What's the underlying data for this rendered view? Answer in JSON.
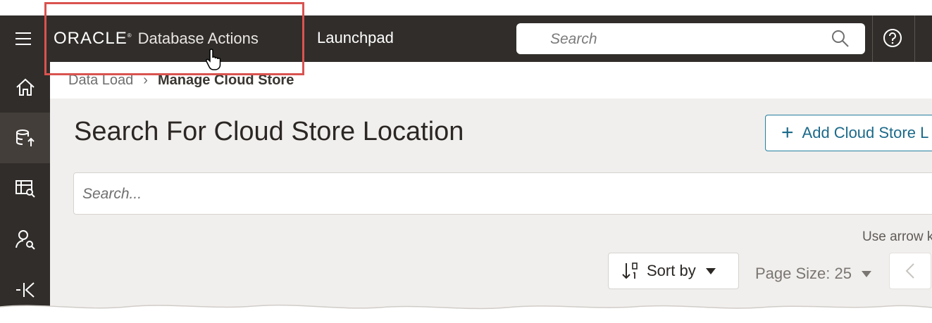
{
  "header": {
    "brand_logo": "ORACLE",
    "brand_product": "Database Actions",
    "page_name": "Launchpad",
    "search_placeholder": "Search"
  },
  "breadcrumb": {
    "parent": "Data Load",
    "current": "Manage Cloud Store"
  },
  "main": {
    "title": "Search For Cloud Store Location",
    "add_button_label": "Add Cloud Store L",
    "search_placeholder": "Search...",
    "hint_text": "Use arrow k",
    "sort_label": "Sort by",
    "page_size_label": "Page Size: 25"
  },
  "leftnav": {
    "items": [
      {
        "icon": "home-icon"
      },
      {
        "icon": "database-upload-icon"
      },
      {
        "icon": "table-search-icon"
      },
      {
        "icon": "user-search-icon"
      },
      {
        "icon": "collapse-icon"
      }
    ]
  },
  "colors": {
    "header_bg": "#312d2a",
    "highlight_border": "#d9534f",
    "accent": "#227e9e",
    "content_bg": "#f1efed"
  }
}
